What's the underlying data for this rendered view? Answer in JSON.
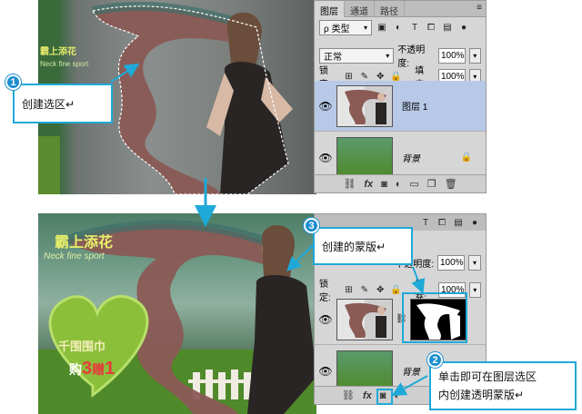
{
  "top_panel": {
    "tabs": [
      "图层",
      "通道",
      "路径"
    ],
    "kind_filter": "ρ 类型",
    "blend_mode": "正常",
    "opacity_label": "不透明度:",
    "opacity_value": "100%",
    "lock_label": "锁定:",
    "fill_label": "填充:",
    "fill_value": "100%",
    "layers": [
      {
        "name": "图层 1",
        "selected": true
      },
      {
        "name": "背景",
        "locked": true
      }
    ]
  },
  "bottom_panel": {
    "opacity_label": "不透明度:",
    "opacity_value": "100%",
    "lock_label": "锁定:",
    "fill_label": "填充:",
    "fill_value": "100%",
    "layers": [
      {
        "name": "",
        "selected": false
      },
      {
        "name": "背景",
        "locked": true
      }
    ]
  },
  "callouts": {
    "c1": {
      "badge": "1",
      "text": "创建选区↵"
    },
    "c2": {
      "badge": "2",
      "line1": "单击即可在图层选区",
      "line2": "内创建透明蒙版↵"
    },
    "c3": {
      "badge": "3",
      "text": "创建的蒙版↵"
    }
  },
  "poster": {
    "title": "霸上添花",
    "subtitle": "Neck fine sport",
    "heart_line1": "千围围巾",
    "heart_line2_a": "购",
    "heart_line2_num1": "3",
    "heart_line2_b": "赠",
    "heart_line2_num2": "1"
  },
  "colors": {
    "accent": "#1fa9d8",
    "badge": "#1d8fd0",
    "selected_layer": "#b7c9e7"
  }
}
